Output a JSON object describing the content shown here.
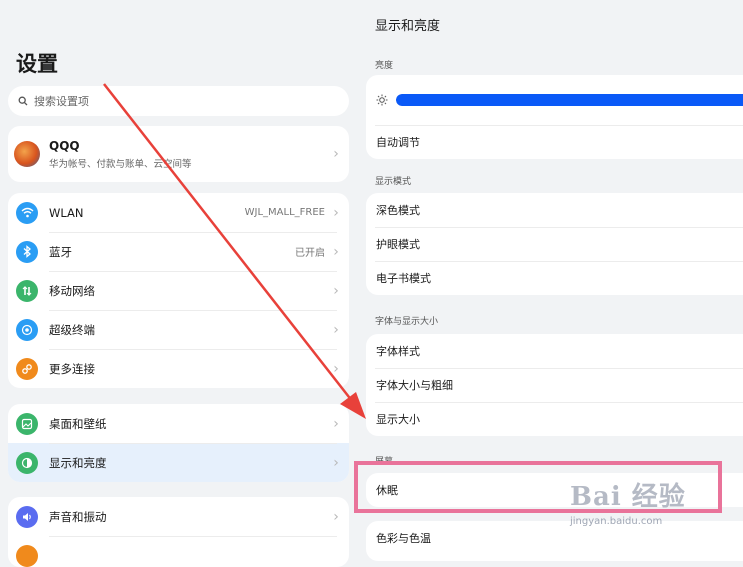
{
  "left": {
    "title": "设置",
    "search_placeholder": "搜索设置项",
    "account": {
      "name": "QQQ",
      "subtitle": "华为帐号、付款与账单、云空间等"
    },
    "group1": [
      {
        "label": "WLAN",
        "value": "WJL_MALL_FREE",
        "icon": "wifi-icon",
        "color": "#2a9df4"
      },
      {
        "label": "蓝牙",
        "value": "已开启",
        "icon": "bluetooth-icon",
        "color": "#2a9df4"
      },
      {
        "label": "移动网络",
        "value": "",
        "icon": "signal-icon",
        "color": "#3bb56b"
      },
      {
        "label": "超级终端",
        "value": "",
        "icon": "super-device-icon",
        "color": "#2a9df4"
      },
      {
        "label": "更多连接",
        "value": "",
        "icon": "link-icon",
        "color": "#f08a1c"
      }
    ],
    "group2": [
      {
        "label": "桌面和壁纸",
        "icon": "wallpaper-icon",
        "color": "#3bb56b"
      },
      {
        "label": "显示和亮度",
        "icon": "display-icon",
        "color": "#3bb56b",
        "selected": true
      }
    ],
    "group3": [
      {
        "label": "声音和振动",
        "icon": "sound-icon",
        "color": "#5a6cf0"
      }
    ]
  },
  "right": {
    "title": "显示和亮度",
    "brightness_label": "亮度",
    "brightness_level": 1.0,
    "auto_adjust": "自动调节",
    "display_mode_label": "显示模式",
    "display_modes": [
      "深色模式",
      "护眼模式",
      "电子书模式"
    ],
    "font_label": "字体与显示大小",
    "font_items": [
      "字体样式",
      "字体大小与粗细",
      "显示大小"
    ],
    "screen_label": "屏幕",
    "sleep": "休眠",
    "color_temp": "色彩与色温"
  },
  "watermark": {
    "main": "Bai 经验",
    "sub": "jingyan.baidu.com"
  },
  "colors": {
    "accent": "#0a59f7",
    "highlight": "#e9739a",
    "arrow": "#e8413a"
  }
}
